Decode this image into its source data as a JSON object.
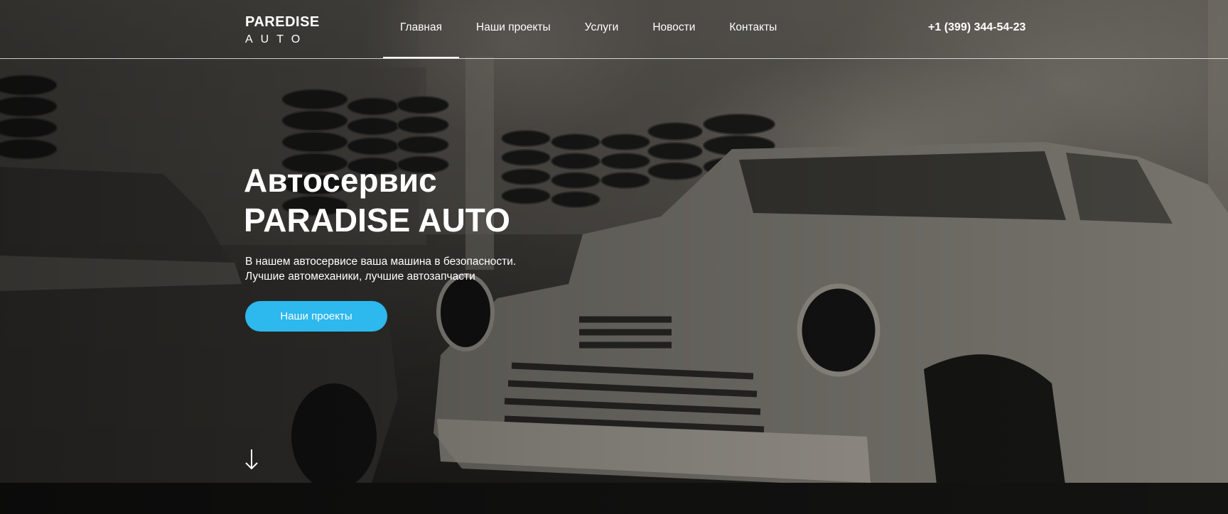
{
  "logo": {
    "line1": "PAREDISE",
    "line2": "AUTO"
  },
  "nav": [
    {
      "label": "Главная",
      "active": true
    },
    {
      "label": "Наши проекты",
      "active": false
    },
    {
      "label": "Услуги",
      "active": false
    },
    {
      "label": "Новости",
      "active": false
    },
    {
      "label": "Контакты",
      "active": false
    }
  ],
  "phone": "+1 (399) 344-54-23",
  "hero": {
    "title_line1": "Автосервис",
    "title_line2": "PARADISE AUTO",
    "subtitle_line1": "В нашем автосервисе ваша машина в безопасности.",
    "subtitle_line2": "Лучшие автомеханики, лучшие автозапчасти",
    "cta_label": "Наши проекты"
  },
  "icons": {
    "scroll": "arrow-down-icon"
  },
  "colors": {
    "accent": "#2db8ee",
    "text": "#ffffff"
  }
}
